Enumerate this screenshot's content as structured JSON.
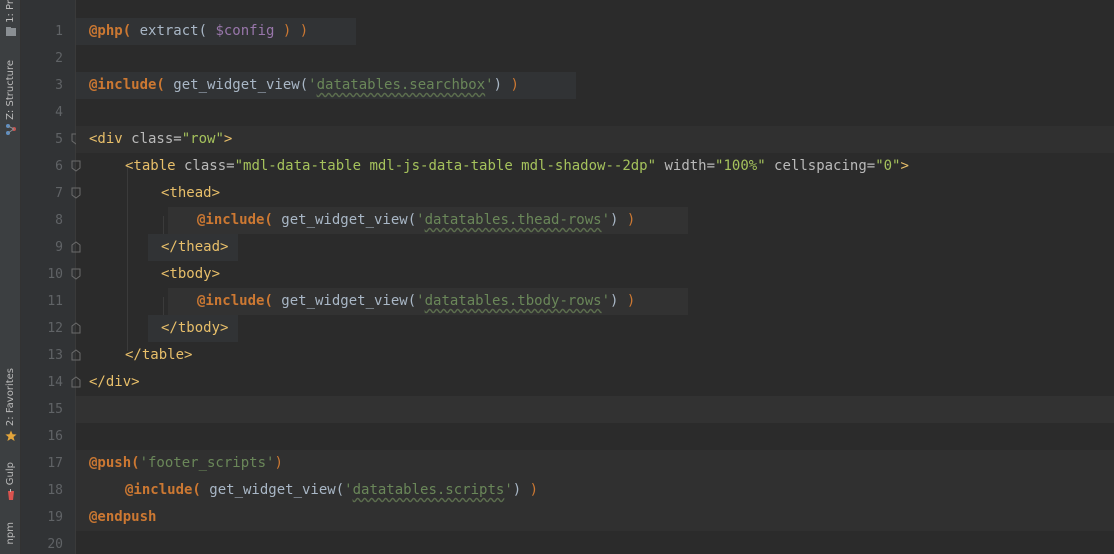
{
  "tool_windows": {
    "project_label": "1: Pr",
    "structure_label": "Z: Structure",
    "favorites_label": "2: Favorites",
    "gulp_label": "Gulp",
    "npm_label": "npm"
  },
  "editor": {
    "line_numbers": [
      "1",
      "2",
      "3",
      "4",
      "5",
      "6",
      "7",
      "8",
      "9",
      "10",
      "11",
      "12",
      "13",
      "14",
      "15",
      "16",
      "17",
      "18",
      "19",
      "20"
    ],
    "lines": {
      "l1": {
        "kw": "@php(",
        "text": " extract( ",
        "var": "$config",
        "end": " ) )"
      },
      "l3": {
        "kw": "@include(",
        "text": " get_widget_view(",
        "q1": "'",
        "str": "datatables.searchbox",
        "q2": "'",
        "end1": ")",
        "end2": " )"
      },
      "l5": {
        "open": "<div",
        "attr": " class=",
        "val": "\"row\"",
        "close": ">"
      },
      "l6": {
        "open": "<table",
        "attr1": " class=",
        "val1": "\"mdl-data-table mdl-js-data-table mdl-shadow--2dp\"",
        "attr2": " width=",
        "val2": "\"100%\"",
        "attr3": " cellspacing=",
        "val3": "\"0\"",
        "close": ">"
      },
      "l7": {
        "tag": "<thead>"
      },
      "l8": {
        "kw": "@include(",
        "text": " get_widget_view(",
        "q1": "'",
        "str": "datatables.thead-rows",
        "q2": "'",
        "end1": ")",
        "end2": " )"
      },
      "l9": {
        "tag": "</thead>"
      },
      "l10": {
        "tag": "<tbody>"
      },
      "l11": {
        "kw": "@include(",
        "text": " get_widget_view(",
        "q1": "'",
        "str": "datatables.tbody-rows",
        "q2": "'",
        "end1": ")",
        "end2": " )"
      },
      "l12": {
        "tag": "</tbody>"
      },
      "l13": {
        "tag": "</table>"
      },
      "l14": {
        "tag": "</div>"
      },
      "l17": {
        "kw": "@push(",
        "str": "'footer_scripts'",
        "end": ")"
      },
      "l18": {
        "kw": "@include(",
        "text": " get_widget_view(",
        "q1": "'",
        "str": "datatables.scripts",
        "q2": "'",
        "end1": ")",
        "end2": " )"
      },
      "l19": {
        "kw": "@endpush"
      }
    }
  },
  "colors": {
    "background": "#2b2b2b",
    "gutter": "#313335",
    "keyword": "#cc7832",
    "string": "#6a8759",
    "tag": "#e8bf6a",
    "attribute_value": "#a5c25c",
    "variable": "#9876aa",
    "line_number": "#606366"
  },
  "icons": [
    "project-icon",
    "structure-icon",
    "favorites-star-icon",
    "gulp-icon",
    "fold-marker-icon"
  ]
}
